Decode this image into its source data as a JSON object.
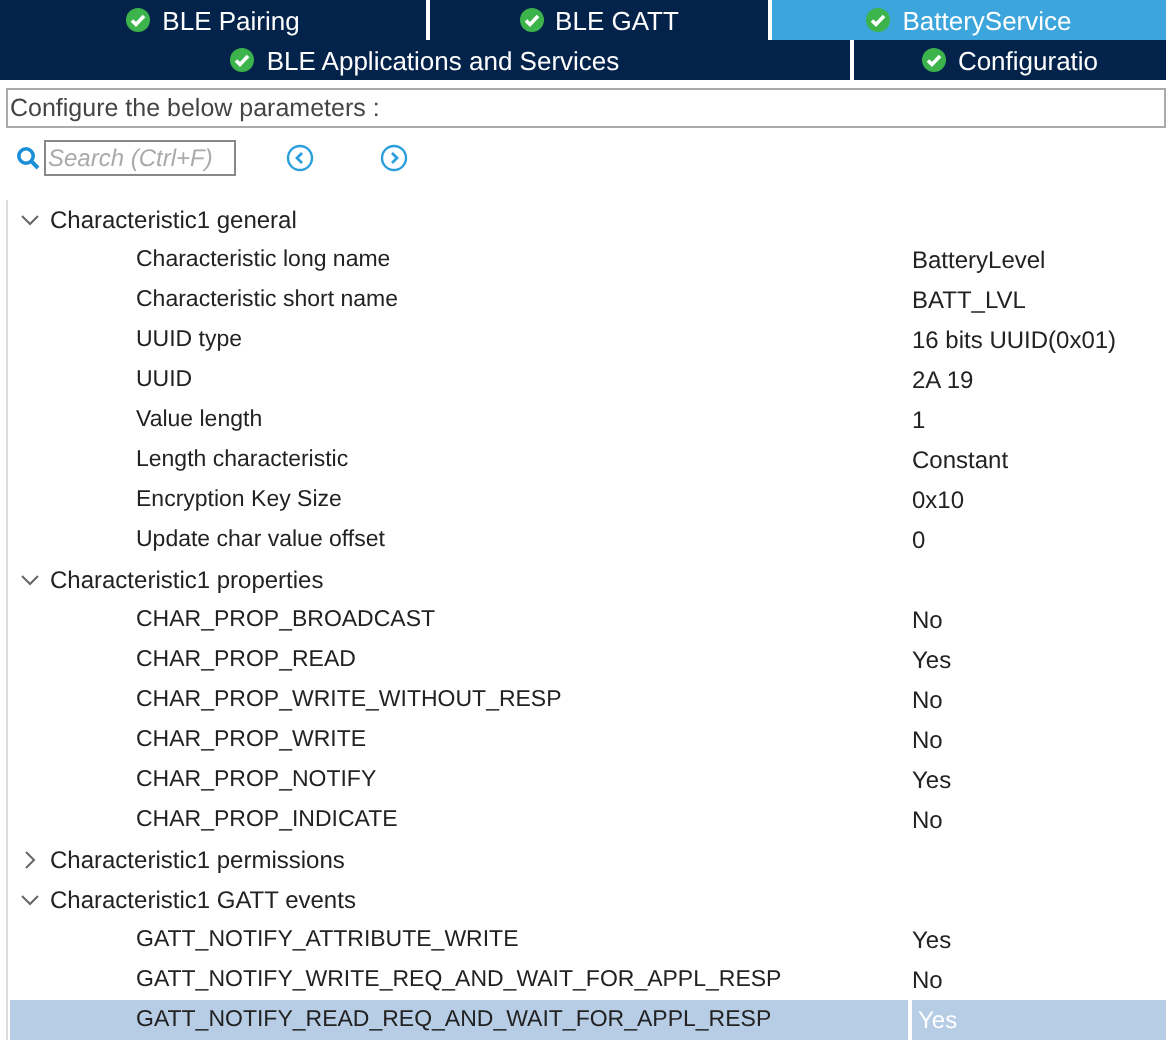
{
  "tabs_row1": [
    {
      "label": "BLE Pairing",
      "selected": false
    },
    {
      "label": "BLE GATT",
      "selected": false
    },
    {
      "label": "BatteryService",
      "selected": true
    }
  ],
  "tabs_row2": [
    {
      "label": "BLE Applications and Services",
      "selected": false
    },
    {
      "label": "Configuratio",
      "selected": false
    }
  ],
  "heading": "Configure the below parameters :",
  "search": {
    "placeholder": "Search (Ctrl+F)"
  },
  "groups": [
    {
      "name": "Characteristic1 general",
      "expanded": true,
      "children": [
        {
          "name": "Characteristic long name",
          "value": "BatteryLevel",
          "selected": false
        },
        {
          "name": "Characteristic short name",
          "value": "BATT_LVL",
          "selected": false
        },
        {
          "name": "UUID type",
          "value": "16 bits UUID(0x01)",
          "selected": false
        },
        {
          "name": "UUID",
          "value": "2A 19",
          "selected": false
        },
        {
          "name": "Value length",
          "value": "1",
          "selected": false
        },
        {
          "name": "Length characteristic",
          "value": "Constant",
          "selected": false
        },
        {
          "name": "Encryption Key Size",
          "value": "0x10",
          "selected": false
        },
        {
          "name": "Update char value offset",
          "value": "0",
          "selected": false
        }
      ]
    },
    {
      "name": "Characteristic1 properties",
      "expanded": true,
      "children": [
        {
          "name": "CHAR_PROP_BROADCAST",
          "value": "No",
          "selected": false
        },
        {
          "name": "CHAR_PROP_READ",
          "value": "Yes",
          "selected": false
        },
        {
          "name": "CHAR_PROP_WRITE_WITHOUT_RESP",
          "value": "No",
          "selected": false
        },
        {
          "name": "CHAR_PROP_WRITE",
          "value": "No",
          "selected": false
        },
        {
          "name": "CHAR_PROP_NOTIFY",
          "value": "Yes",
          "selected": false
        },
        {
          "name": "CHAR_PROP_INDICATE",
          "value": "No",
          "selected": false
        }
      ]
    },
    {
      "name": "Characteristic1 permissions",
      "expanded": false
    },
    {
      "name": "Characteristic1 GATT events",
      "expanded": true,
      "children": [
        {
          "name": "GATT_NOTIFY_ATTRIBUTE_WRITE",
          "value": "Yes",
          "selected": false
        },
        {
          "name": "GATT_NOTIFY_WRITE_REQ_AND_WAIT_FOR_APPL_RESP",
          "value": "No",
          "selected": false
        },
        {
          "name": "GATT_NOTIFY_READ_REQ_AND_WAIT_FOR_APPL_RESP",
          "value": "Yes",
          "selected": true
        }
      ]
    }
  ]
}
